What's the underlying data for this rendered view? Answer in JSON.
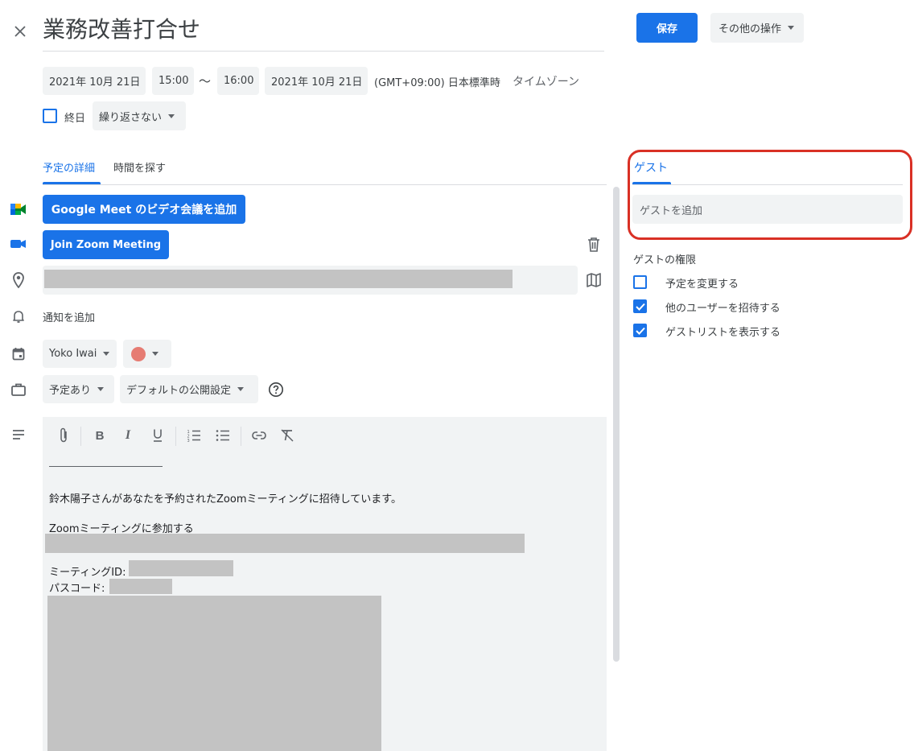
{
  "header": {
    "title": "業務改善打合せ",
    "save_label": "保存",
    "more_actions_label": "その他の操作"
  },
  "datetime": {
    "start_date": "2021年 10月 21日",
    "start_time": "15:00",
    "separator": "〜",
    "end_time": "16:00",
    "end_date": "2021年 10月 21日",
    "timezone_text": "(GMT+09:00) 日本標準時",
    "timezone_link": "タイムゾーン",
    "all_day_label": "終日",
    "repeat_label": "繰り返さない"
  },
  "tabs": {
    "details": "予定の詳細",
    "find_time": "時間を探す"
  },
  "conference": {
    "meet_button": "Google Meet のビデオ会議を追加",
    "zoom_button": "Join Zoom Meeting"
  },
  "notification": {
    "add_label": "通知を追加"
  },
  "calendar": {
    "owner": "Yoko Iwai",
    "color": "#e67c73"
  },
  "availability": {
    "busy_label": "予定あり",
    "visibility_label": "デフォルトの公開設定"
  },
  "description": {
    "divider_line": "____________________",
    "invite_text": "鈴木陽子さんがあなたを予約されたZoomミーティングに招待しています。",
    "join_label": "Zoomミーティングに参加する",
    "meeting_id_label": "ミーティングID:",
    "passcode_label": "パスコード:"
  },
  "guests": {
    "tab_label": "ゲスト",
    "add_placeholder": "ゲストを追加",
    "permissions_title": "ゲストの権限",
    "permissions": [
      {
        "label": "予定を変更する",
        "checked": false
      },
      {
        "label": "他のユーザーを招待する",
        "checked": true
      },
      {
        "label": "ゲストリストを表示する",
        "checked": true
      }
    ]
  },
  "colors": {
    "accent": "#1a73e8",
    "highlight_box": "#d93025"
  }
}
